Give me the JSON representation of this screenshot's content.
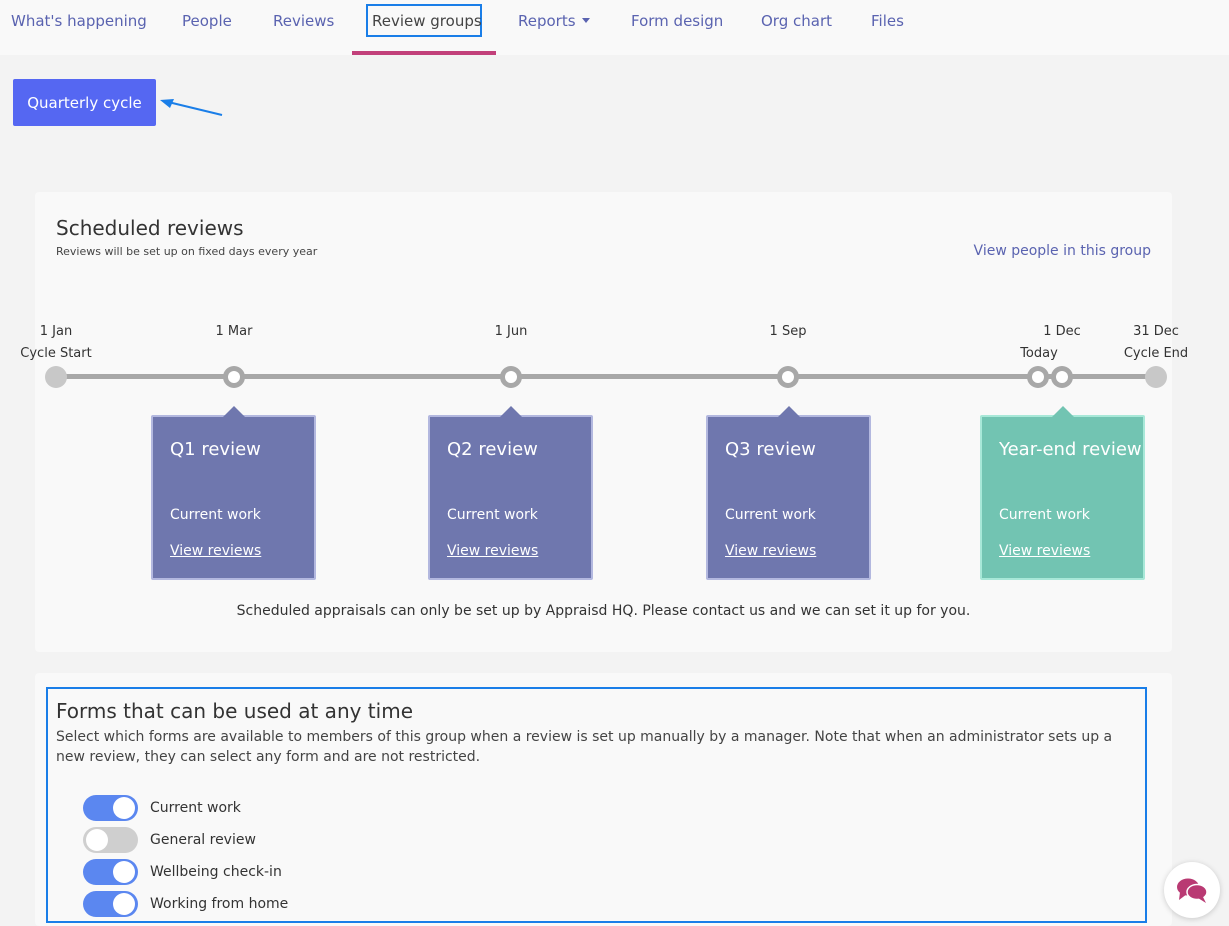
{
  "nav": {
    "items": [
      {
        "label": "What's happening"
      },
      {
        "label": "People"
      },
      {
        "label": "Reviews"
      },
      {
        "label": "Review groups"
      },
      {
        "label": "Reports"
      },
      {
        "label": "Form design"
      },
      {
        "label": "Org chart"
      },
      {
        "label": "Files"
      }
    ],
    "active": "Review groups"
  },
  "group_button": {
    "label": "Quarterly cycle"
  },
  "scheduled": {
    "title": "Scheduled reviews",
    "subtitle": "Reviews will be set up on fixed days every year",
    "view_people": "View people in this group",
    "timeline": {
      "start": {
        "date": "1 Jan",
        "label": "Cycle Start"
      },
      "end": {
        "date": "31 Dec",
        "label": "Cycle End"
      },
      "points": [
        {
          "date": "1 Mar"
        },
        {
          "date": "1 Jun"
        },
        {
          "date": "1 Sep"
        },
        {
          "date": "Today"
        },
        {
          "date": "1 Dec"
        }
      ]
    },
    "reviews": [
      {
        "title": "Q1 review",
        "form": "Current work",
        "link": "View reviews"
      },
      {
        "title": "Q2 review",
        "form": "Current work",
        "link": "View reviews"
      },
      {
        "title": "Q3 review",
        "form": "Current work",
        "link": "View reviews"
      },
      {
        "title": "Year-end review",
        "form": "Current work",
        "link": "View reviews"
      }
    ],
    "note": "Scheduled appraisals can only be set up by Appraisd HQ. Please contact us and we can set it up for you."
  },
  "forms": {
    "title": "Forms that can be used at any time",
    "description": "Select which forms are available to members of this group when a review is set up manually by a manager. Note that when an administrator sets up a new review, they can select any form and are not restricted.",
    "items": [
      {
        "label": "Current work",
        "enabled": true
      },
      {
        "label": "General review",
        "enabled": false
      },
      {
        "label": "Wellbeing check-in",
        "enabled": true
      },
      {
        "label": "Working from home",
        "enabled": true
      }
    ]
  },
  "colors": {
    "accent": "#5567f2",
    "nav_link": "#5a63b0",
    "nav_underline": "#c2407a",
    "review_box": "#6f77ae",
    "year_end_box": "#72c4b2",
    "highlight": "#1a7ee8",
    "chat_icon": "#b93a73"
  },
  "icons": {
    "chat": "chat-bubbles-icon",
    "reports_dropdown": "caret-down-icon"
  }
}
